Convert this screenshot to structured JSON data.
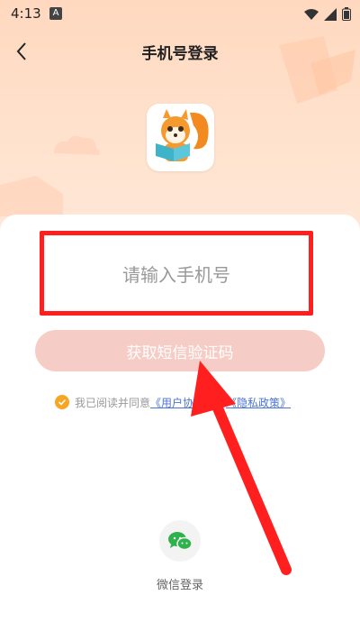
{
  "status_bar": {
    "time": "4:13",
    "badge": "A"
  },
  "header": {
    "title": "手机号登录"
  },
  "login": {
    "phone_placeholder": "请输入手机号",
    "sms_button": "获取短信验证码",
    "agree_prefix": "我已阅读并同意",
    "user_agreement": "《用户协议》",
    "agree_and": "和",
    "privacy_policy": "《隐私政策》"
  },
  "alt_login": {
    "wechat_label": "微信登录"
  },
  "colors": {
    "accent_orange": "#f6a623",
    "button_disabled": "#f6cdc6",
    "highlight_red": "#ff1f1f",
    "link_blue": "#4a74d6"
  }
}
